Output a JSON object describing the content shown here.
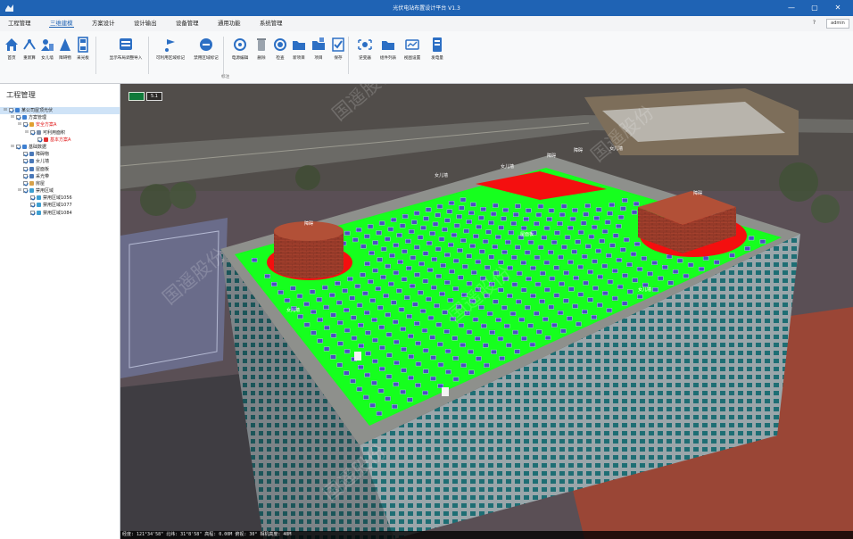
{
  "app": {
    "title": "光伏电站布置设计平台 V1.3",
    "minimize_glyph": "—",
    "maximize_glyph": "▢",
    "close_glyph": "✕",
    "brand_color": "#1f63b4"
  },
  "menu": {
    "items": [
      "工程管理",
      "三维建模",
      "方案设计",
      "设计输出",
      "设备管理",
      "通用功能",
      "系统管理"
    ],
    "active_index": 1,
    "help_glyph": "?",
    "user": "admin"
  },
  "ribbon": {
    "buttons": [
      {
        "label": "首页",
        "icon": "home-icon"
      },
      {
        "label": "重新算",
        "icon": "recalc-icon"
      },
      {
        "label": "女儿墙",
        "icon": "parapet-icon"
      },
      {
        "label": "障碍物",
        "icon": "obstacle-icon"
      },
      {
        "label": "采光板",
        "icon": "skylight-icon"
      },
      {
        "label": "显示布局调整导入",
        "icon": "layout-import-icon"
      },
      {
        "label": "可利用区域标记",
        "icon": "usable-area-icon"
      },
      {
        "label": "禁用区域标记",
        "icon": "forbidden-area-icon"
      },
      {
        "label": "电源编辑",
        "icon": "power-edit-icon"
      },
      {
        "label": "删除",
        "icon": "delete-icon"
      },
      {
        "label": "检查",
        "icon": "check-icon"
      },
      {
        "label": "新项目",
        "icon": "new-project-icon"
      },
      {
        "label": "项目",
        "icon": "project-icon"
      },
      {
        "label": "保存",
        "icon": "save-icon"
      },
      {
        "label": "逆变器",
        "icon": "inverter-icon"
      },
      {
        "label": "组件列表",
        "icon": "component-list-icon"
      },
      {
        "label": "视图设置",
        "icon": "view-settings-icon"
      },
      {
        "label": "发电量",
        "icon": "generation-icon"
      }
    ],
    "group_label": "标注"
  },
  "sidebar": {
    "title": "工程管理",
    "tree": [
      {
        "label": "某公司屋顶光伏",
        "depth": 0,
        "expand": "⊟",
        "checked": true,
        "red": false,
        "selected": true,
        "icon_color": "#3d7fd1"
      },
      {
        "label": "方案管理",
        "depth": 1,
        "expand": "⊟",
        "checked": true,
        "red": false,
        "selected": false,
        "icon_color": "#3d7fd1"
      },
      {
        "label": "安全方案A",
        "depth": 2,
        "expand": "⊟",
        "checked": true,
        "red": true,
        "selected": false,
        "icon_color": "#e0a030"
      },
      {
        "label": "可利用面积",
        "depth": 3,
        "expand": "⊟",
        "checked": true,
        "red": false,
        "selected": false,
        "icon_color": "#7a8ea8"
      },
      {
        "label": "基本方案A",
        "depth": 4,
        "expand": "",
        "checked": true,
        "red": true,
        "selected": false,
        "icon_color": "#e03030"
      },
      {
        "label": "基础数据",
        "depth": 1,
        "expand": "⊟",
        "checked": true,
        "red": false,
        "selected": false,
        "icon_color": "#3d7fd1"
      },
      {
        "label": "障碍物",
        "depth": 2,
        "expand": "",
        "checked": true,
        "red": false,
        "selected": false,
        "icon_color": "#4a78b8"
      },
      {
        "label": "女儿墙",
        "depth": 2,
        "expand": "",
        "checked": true,
        "red": false,
        "selected": false,
        "icon_color": "#4a78b8"
      },
      {
        "label": "屋面板",
        "depth": 2,
        "expand": "",
        "checked": true,
        "red": false,
        "selected": false,
        "icon_color": "#4a78b8"
      },
      {
        "label": "采光带",
        "depth": 2,
        "expand": "",
        "checked": true,
        "red": false,
        "selected": false,
        "icon_color": "#4a78b8"
      },
      {
        "label": "房屋",
        "depth": 2,
        "expand": "",
        "checked": true,
        "red": false,
        "selected": false,
        "icon_color": "#d6a14a"
      },
      {
        "label": "禁用区域",
        "depth": 2,
        "expand": "⊟",
        "checked": true,
        "red": false,
        "selected": false,
        "icon_color": "#3d9fd1"
      },
      {
        "label": "禁用区域1056",
        "depth": 3,
        "expand": "",
        "checked": true,
        "red": false,
        "selected": false,
        "icon_color": "#3d9fd1"
      },
      {
        "label": "禁用区域1077",
        "depth": 3,
        "expand": "",
        "checked": true,
        "red": false,
        "selected": false,
        "icon_color": "#3d9fd1"
      },
      {
        "label": "禁用区域1084",
        "depth": 3,
        "expand": "",
        "checked": true,
        "red": false,
        "selected": false,
        "icon_color": "#3d9fd1"
      }
    ]
  },
  "viewport": {
    "scale_label": "5.1",
    "scene_labels": [
      {
        "text": "女儿墙"
      },
      {
        "text": "障碍"
      },
      {
        "text": "女儿墙"
      },
      {
        "text": "障碍"
      },
      {
        "text": "障碍"
      },
      {
        "text": "女儿墙"
      },
      {
        "text": "障碍"
      },
      {
        "text": "屋面板"
      },
      {
        "text": "女儿墙"
      },
      {
        "text": "女儿墙"
      }
    ],
    "watermarks": [
      "国遥股份",
      "国遥股份",
      "国遥股份",
      "国遥股份",
      "国遥股份",
      "国遥股份"
    ],
    "colors": {
      "roof_green": "#16ff1e",
      "forbidden_red": "#f40f0f",
      "panel_blue": "#4b4fc2",
      "brick": "#a4402d"
    }
  },
  "status": {
    "text": "经度: 121°34'58\"  北纬: 31°8'58\"  高程: 0.00M  俯视: 30°  相机高度: 40M"
  }
}
